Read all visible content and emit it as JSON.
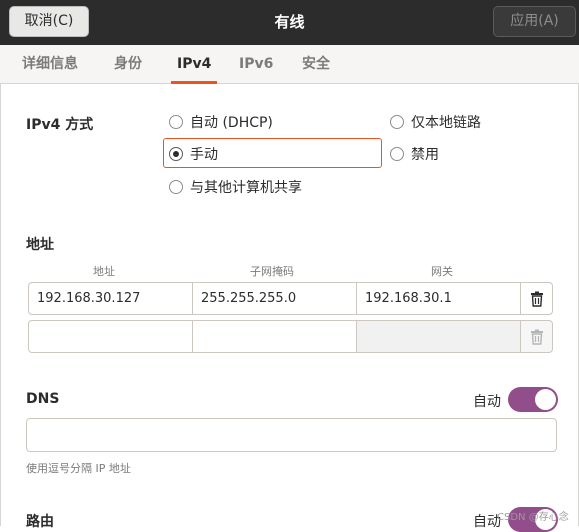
{
  "header": {
    "cancel_label": "取消(C)",
    "title": "有线",
    "apply_label": "应用(A)"
  },
  "tabs": [
    {
      "label": "详细信息",
      "active": false
    },
    {
      "label": "身份",
      "active": false
    },
    {
      "label": "IPv4",
      "active": true
    },
    {
      "label": "IPv6",
      "active": false
    },
    {
      "label": "安全",
      "active": false
    }
  ],
  "ipv4_method": {
    "label": "IPv4 方式",
    "options": [
      {
        "label": "自动 (DHCP)",
        "checked": false
      },
      {
        "label": "仅本地链路",
        "checked": false
      },
      {
        "label": "手动",
        "checked": true
      },
      {
        "label": "禁用",
        "checked": false
      },
      {
        "label": "与其他计算机共享",
        "checked": false
      }
    ]
  },
  "addresses": {
    "label": "地址",
    "columns": [
      "地址",
      "子网掩码",
      "网关"
    ],
    "rows": [
      [
        "192.168.30.127",
        "255.255.255.0",
        "192.168.30.1"
      ],
      [
        "",
        "",
        ""
      ]
    ]
  },
  "dns": {
    "label": "DNS",
    "auto_label": "自动",
    "auto_enabled": true,
    "value": "",
    "hint": "使用逗号分隔 IP 地址"
  },
  "routes": {
    "label": "路由",
    "auto_label": "自动",
    "auto_enabled": true
  },
  "watermark": "CSDN @存心念",
  "colors": {
    "header_bg": "#2c2c2c",
    "accent": "#e95420",
    "switch_on": "#924d8b"
  }
}
